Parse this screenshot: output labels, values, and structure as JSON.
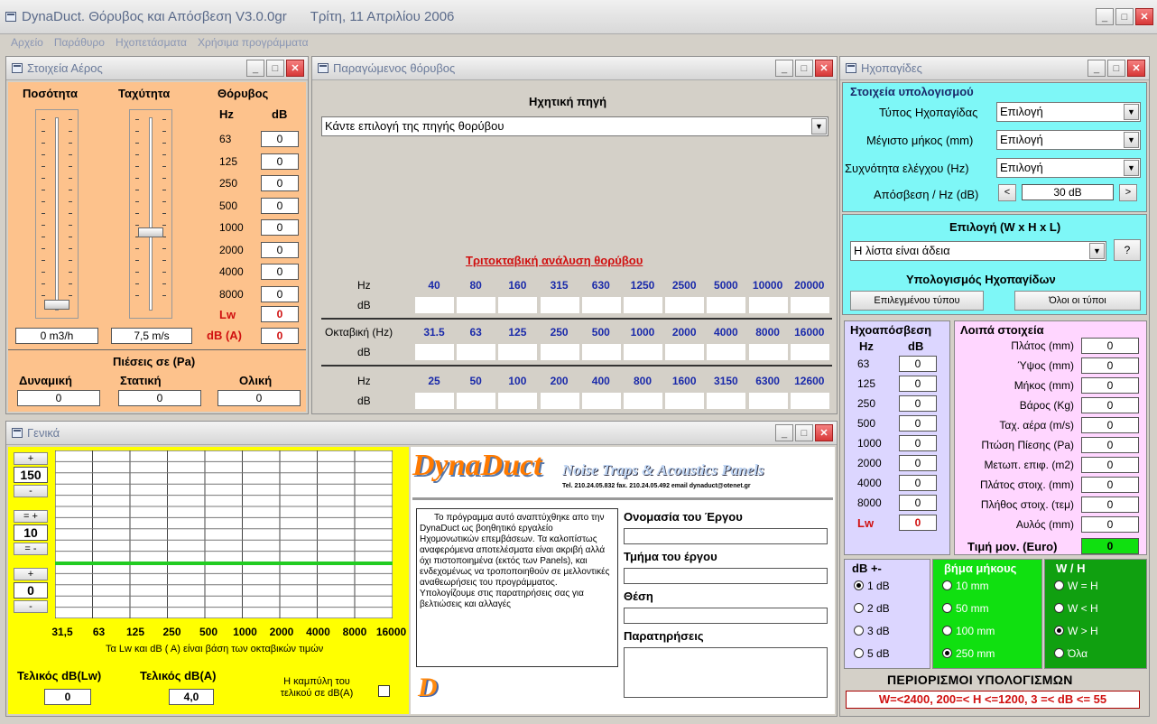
{
  "app": {
    "title": "DynaDuct. Θόρυβος και Απόσβεση V3.0.0gr",
    "date": "Τρίτη, 11 Απριλίου 2006"
  },
  "menu": [
    "Αρχείο",
    "Παράθυρο",
    "Ηχοπετάσματα",
    "Χρήσιμα προγράμματα"
  ],
  "air": {
    "title": "Στοιχεία Αέρος",
    "col_pct": "Ποσότητα",
    "col_speed": "Ταχύτητα",
    "col_noise": "Θόρυβος",
    "hz": "Hz",
    "db": "dB",
    "rows": [
      {
        "hz": "63",
        "v": "0"
      },
      {
        "hz": "125",
        "v": "0"
      },
      {
        "hz": "250",
        "v": "0"
      },
      {
        "hz": "500",
        "v": "0"
      },
      {
        "hz": "1000",
        "v": "0"
      },
      {
        "hz": "2000",
        "v": "0"
      },
      {
        "hz": "4000",
        "v": "0"
      },
      {
        "hz": "8000",
        "v": "0"
      }
    ],
    "lw_label": "Lw",
    "lw": "0",
    "dba_label": "dB (A)",
    "dba": "0",
    "flow": "0 m3/h",
    "speed": "7,5 m/s",
    "flow_slider": 0.0,
    "speed_slider": 0.4,
    "press_title": "Πιέσεις σε (Pa)",
    "dyn": "Δυναμική",
    "stat": "Στατική",
    "tot": "Ολική",
    "dyn_v": "0",
    "stat_v": "0",
    "tot_v": "0"
  },
  "noise": {
    "title": "Παραγώμενος θόρυβος",
    "source_label": "Ηχητική πηγή",
    "source_sel": "Κάντε επιλογή της πηγής θορύβου",
    "third_title": "Τριτοκταβική ανάλυση θορύβου",
    "hz": "Hz",
    "db": "dB",
    "octave": "Οκταβική (Hz)",
    "row1": [
      "40",
      "80",
      "160",
      "315",
      "630",
      "1250",
      "2500",
      "5000",
      "10000",
      "20000"
    ],
    "row2": [
      "31.5",
      "63",
      "125",
      "250",
      "500",
      "1000",
      "2000",
      "4000",
      "8000",
      "16000"
    ],
    "row3": [
      "25",
      "50",
      "100",
      "200",
      "400",
      "800",
      "1600",
      "3150",
      "6300",
      "12600"
    ]
  },
  "sil": {
    "title": "Ηχοπαγίδες",
    "calc_title": "Στοιχεία υπολογισμού",
    "type_l": "Τύπος Ηχοπαγίδας",
    "type_v": "Επιλογή",
    "maxlen_l": "Μέγιστο μήκος (mm)",
    "maxlen_v": "Επιλογή",
    "freq_l": "Συχνότητα ελέγχου (Hz)",
    "freq_v": "Επιλογή",
    "att_l": "Απόσβεση / Hz (dB)",
    "att_v": "30 dB",
    "sel_title": "Επιλογή (W x H x L)",
    "list_v": "Η λίστα είναι άδεια",
    "help": "?",
    "calc2": "Υπολογισμός Ηχοπαγίδων",
    "btn_sel": "Επιλεγμένου τύπου",
    "btn_all": "Όλοι οι τύποι",
    "att_title": "Ηχοαπόσβεση",
    "hz": "Hz",
    "db": "dB",
    "att_rows": [
      {
        "hz": "63",
        "v": "0"
      },
      {
        "hz": "125",
        "v": "0"
      },
      {
        "hz": "250",
        "v": "0"
      },
      {
        "hz": "500",
        "v": "0"
      },
      {
        "hz": "1000",
        "v": "0"
      },
      {
        "hz": "2000",
        "v": "0"
      },
      {
        "hz": "4000",
        "v": "0"
      },
      {
        "hz": "8000",
        "v": "0"
      }
    ],
    "lw_l": "Lw",
    "lw_v": "0",
    "other_title": "Λοιπά στοιχεία",
    "other": [
      {
        "l": "Πλάτος (mm)",
        "v": "0"
      },
      {
        "l": "Ύψος (mm)",
        "v": "0"
      },
      {
        "l": "Μήκος (mm)",
        "v": "0"
      },
      {
        "l": "Βάρος (Kg)",
        "v": "0"
      },
      {
        "l": "Ταχ. αέρα (m/s)",
        "v": "0"
      },
      {
        "l": "Πτώση Πίεσης (Pa)",
        "v": "0"
      },
      {
        "l": "Μετωπ. επιφ. (m2)",
        "v": "0"
      },
      {
        "l": "Πλάτος στοιχ. (mm)",
        "v": "0"
      },
      {
        "l": "Πλήθος στοιχ. (τεμ)",
        "v": "0"
      },
      {
        "l": "Αυλός (mm)",
        "v": "0"
      }
    ],
    "price_l": "Τιμή μον. (Euro)",
    "price_v": "0",
    "db_title": "dB +-",
    "db_opts": [
      "1 dB",
      "2 dB",
      "3 dB",
      "5 dB"
    ],
    "step_title": "βήμα μήκους",
    "step_opts": [
      "10 mm",
      "50 mm",
      "100 mm",
      "250 mm"
    ],
    "wh_title": "W / H",
    "wh_opts": [
      "W = H",
      "W < H",
      "W > H",
      "Όλα"
    ],
    "limits_title": "ΠΕΡΙΟΡΙΣΜΟΙ ΥΠΟΛΟΓΙΣΜΩΝ",
    "limits": "W=<2400, 200=< H <=1200,  3 =< dB <= 55"
  },
  "gen": {
    "title": "Γενικά",
    "plus": "+",
    "minus": "-",
    "eqplus": "= +",
    "eqminus": "= -",
    "v1": "150",
    "v2": "10",
    "v3": "0",
    "chart_x": [
      "31,5",
      "63",
      "125",
      "250",
      "500",
      "1000",
      "2000",
      "4000",
      "8000",
      "16000"
    ],
    "chart_note": "Τα Lw και dB ( A)   είναι βάση των οκταβικών τιμών",
    "final_lw_l": "Τελικός dB(Lw)",
    "final_lw": "0",
    "final_a_l": "Τελικός dB(A)",
    "final_a": "4,0",
    "curve_l": "Η καμπύλη του τελικού σε dB(A)",
    "brand": "DynaDuct",
    "brand_sub": "Noise Traps & Acoustics Panels",
    "contact": "Tel. 210.24.05.832 fax. 210.24.05.492 email dynaduct@otenet.gr",
    "about": "Το πρόγραμμα αυτό αναπτύχθηκε απο την DynaDuct ως βοηθητικό εργαλείο Ηχομονωτικών επεμβάσεων. Τα καλοπίστως αναφερόμενα αποτελέσματα είναι ακριβή αλλά όχι πιστοποιημένα (εκτός των Panels), και ενδεχομένως να τροποποιηθούν σε μελλοντικές αναθεωρήσεις του προγράμματος. Υπολογίζουμε στις παρατηρήσεις σας για βελτιώσεις και αλλαγές",
    "proj_name": "Ονομασία του Έργου",
    "proj_part": "Τμήμα του έργου",
    "proj_pos": "Θέση",
    "proj_notes": "Παρατηρήσεις",
    "logo": "D"
  },
  "colors": {
    "orange": "#fdc28c",
    "cyan": "#7ef7f7",
    "lavender": "#dcd6ff",
    "pink": "#ffd6ff",
    "green": "#10e010",
    "yellow": "#ffff00"
  }
}
